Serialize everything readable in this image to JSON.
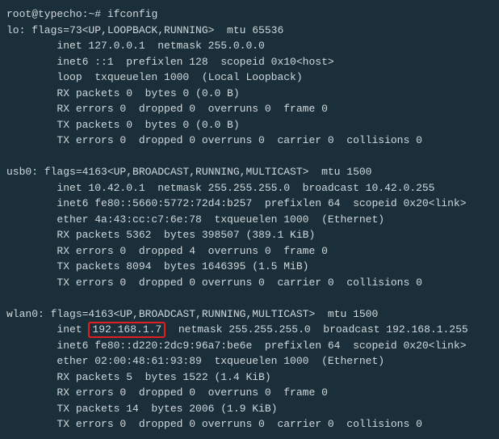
{
  "prompt": {
    "user_host": "root@typecho",
    "path": "~#",
    "command": "ifconfig"
  },
  "interfaces": {
    "lo": {
      "header": "lo: flags=73<UP,LOOPBACK,RUNNING>  mtu 65536",
      "inet": "        inet 127.0.0.1  netmask 255.0.0.0",
      "inet6": "        inet6 ::1  prefixlen 128  scopeid 0x10<host>",
      "loop": "        loop  txqueuelen 1000  (Local Loopback)",
      "rx_packets": "        RX packets 0  bytes 0 (0.0 B)",
      "rx_errors": "        RX errors 0  dropped 0  overruns 0  frame 0",
      "tx_packets": "        TX packets 0  bytes 0 (0.0 B)",
      "tx_errors": "        TX errors 0  dropped 0 overruns 0  carrier 0  collisions 0"
    },
    "usb0": {
      "header": "usb0: flags=4163<UP,BROADCAST,RUNNING,MULTICAST>  mtu 1500",
      "inet": "        inet 10.42.0.1  netmask 255.255.255.0  broadcast 10.42.0.255",
      "inet6": "        inet6 fe80::5660:5772:72d4:b257  prefixlen 64  scopeid 0x20<link>",
      "ether": "        ether 4a:43:cc:c7:6e:78  txqueuelen 1000  (Ethernet)",
      "rx_packets": "        RX packets 5362  bytes 398507 (389.1 KiB)",
      "rx_errors": "        RX errors 0  dropped 4  overruns 0  frame 0",
      "tx_packets": "        TX packets 8094  bytes 1646395 (1.5 MiB)",
      "tx_errors": "        TX errors 0  dropped 0 overruns 0  carrier 0  collisions 0"
    },
    "wlan0": {
      "header": "wlan0: flags=4163<UP,BROADCAST,RUNNING,MULTICAST>  mtu 1500",
      "inet_prefix": "        inet ",
      "inet_ip": "192.168.1.7",
      "inet_suffix": "  netmask 255.255.255.0  broadcast 192.168.1.255",
      "inet6": "        inet6 fe80::d220:2dc9:96a7:be6e  prefixlen 64  scopeid 0x20<link>",
      "ether": "        ether 02:00:48:61:93:89  txqueuelen 1000  (Ethernet)",
      "rx_packets": "        RX packets 5  bytes 1522 (1.4 KiB)",
      "rx_errors": "        RX errors 0  dropped 0  overruns 0  frame 0",
      "tx_packets": "        TX packets 14  bytes 2006 (1.9 KiB)",
      "tx_errors": "        TX errors 0  dropped 0 overruns 0  carrier 0  collisions 0"
    }
  }
}
